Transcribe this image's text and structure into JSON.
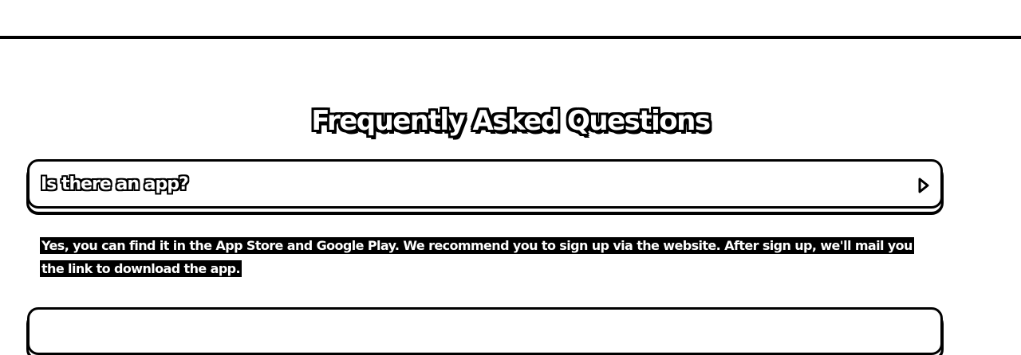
{
  "page": {
    "title": "Frequently Asked Questions"
  },
  "faq": {
    "items": [
      {
        "question": "Is there an app?",
        "expanded": true,
        "answer": "Yes, you can find it in the App Store and Google Play. We recommend you to sign up via the website. After sign up, we'll mail you the link to download the app.",
        "icon": "chevron-right-icon"
      },
      {
        "question": "",
        "expanded": false,
        "icon": "chevron-right-icon"
      }
    ]
  },
  "colors": {
    "background": "#ffffff",
    "ink": "#000000"
  }
}
